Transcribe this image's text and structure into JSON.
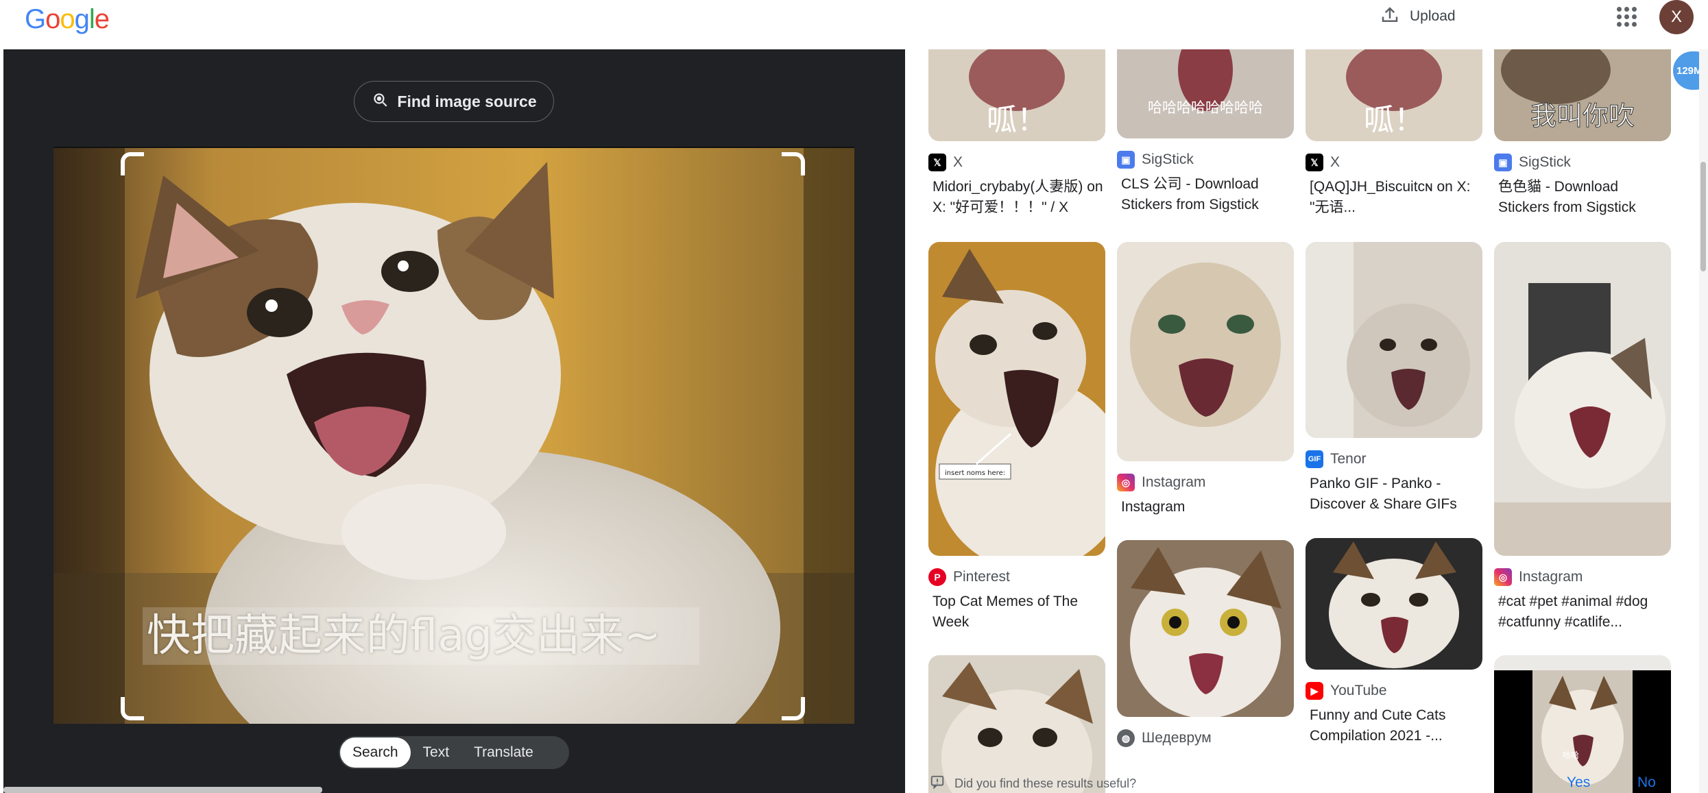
{
  "header": {
    "logo_letters": [
      {
        "ch": "G",
        "color": "#4285F4"
      },
      {
        "ch": "o",
        "color": "#EA4335"
      },
      {
        "ch": "o",
        "color": "#FBBC05"
      },
      {
        "ch": "g",
        "color": "#4285F4"
      },
      {
        "ch": "l",
        "color": "#34A853"
      },
      {
        "ch": "e",
        "color": "#EA4335"
      }
    ],
    "upload_label": "Upload",
    "avatar_letter": "X"
  },
  "left_pane": {
    "find_source_label": "Find image source",
    "image_caption": "快把藏起来的flag交出来~",
    "modes": [
      "Search",
      "Text",
      "Translate"
    ],
    "active_mode": "Search"
  },
  "memory_badge": "129M",
  "results": {
    "top_row": [
      {
        "source": "X",
        "icon": "x-logo-icon",
        "title": "Midori_crybaby(人妻版) on X: \"好可爱！！！\" / X",
        "thumb_text": "呱！"
      },
      {
        "source": "SigStick",
        "icon": "sigstick-icon",
        "title": "CLS 公司 - Download Stickers from Sigstick",
        "thumb_text": "哈哈哈哈哈哈哈哈"
      },
      {
        "source": "X",
        "icon": "x-logo-icon",
        "title": "[QAQ]JH_Biscuitcɴ on X: \"无语...",
        "thumb_text": "呱！"
      },
      {
        "source": "SigStick",
        "icon": "sigstick-icon",
        "title": "色色貓 - Download Stickers from Sigstick",
        "thumb_text": "我叫你吹"
      }
    ],
    "row2": [
      {
        "source": "Pinterest",
        "icon": "pinterest-icon",
        "title": "Top Cat Memes of The Week",
        "thumb_text": "insert noms here:"
      },
      {
        "source": "Instagram",
        "icon": "instagram-icon",
        "title": "Instagram"
      },
      {
        "source": "Tenor",
        "icon": "tenor-gif-icon",
        "icon_text": "GIF",
        "title": "Panko GIF - Panko - Discover & Share GIFs"
      },
      {
        "source": "Instagram",
        "icon": "instagram-icon",
        "title": "#cat #pet #animal #dog #catfunny #catlife..."
      }
    ],
    "row3": [
      {
        "source": "Шедеврум",
        "icon": "globe-icon"
      },
      {
        "source": "YouTube",
        "icon": "youtube-icon",
        "title": "Funny and Cute Cats Compilation 2021 -..."
      }
    ],
    "extra_thumb_text": "哈哈"
  },
  "feedback": {
    "question": "Did you find these results useful?",
    "yes": "Yes",
    "no": "No"
  },
  "colors": {
    "dark_bg": "#202124",
    "link_blue": "#1a73e8",
    "badge_blue": "#4f9ce8"
  }
}
